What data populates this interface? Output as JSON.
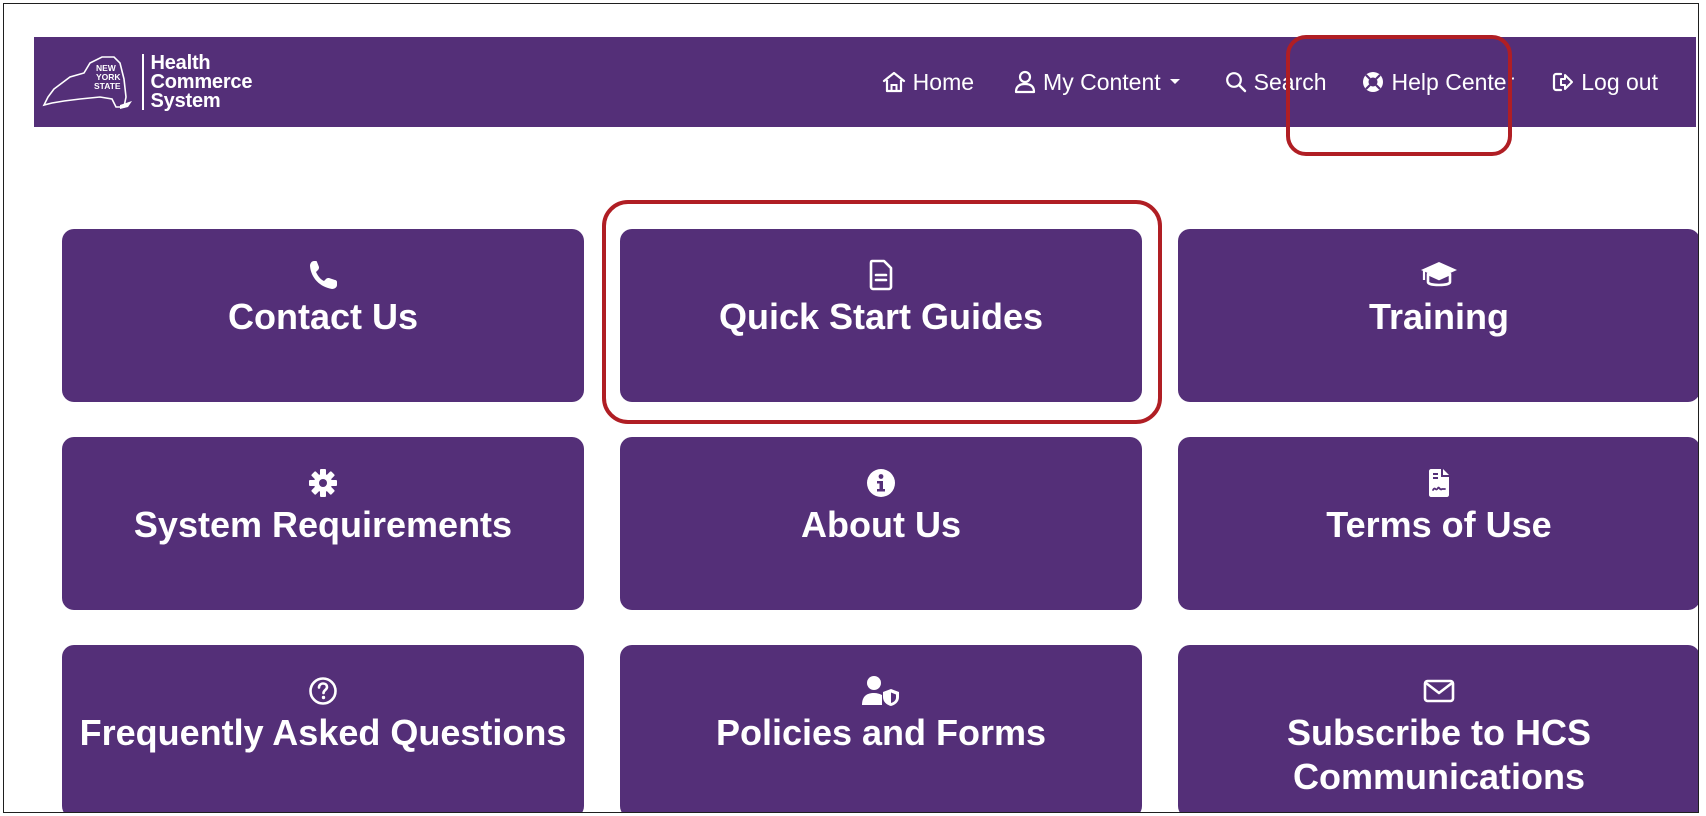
{
  "logo": {
    "state_lines": [
      "NEW",
      "YORK",
      "STATE"
    ],
    "system_lines": [
      "Health",
      "Commerce",
      "System"
    ]
  },
  "nav": {
    "items": [
      {
        "label": "Home",
        "icon": "home-icon"
      },
      {
        "label": "My Content",
        "icon": "user-icon",
        "has_dropdown": true
      },
      {
        "label": "Search",
        "icon": "search-icon"
      },
      {
        "label": "Help Center",
        "icon": "life-ring-icon"
      },
      {
        "label": "Log out",
        "icon": "logout-icon"
      }
    ]
  },
  "tiles": [
    {
      "label": "Contact Us",
      "icon": "phone-icon"
    },
    {
      "label": "Quick Start Guides",
      "icon": "document-icon"
    },
    {
      "label": "Training",
      "icon": "graduation-cap-icon"
    },
    {
      "label": "System Requirements",
      "icon": "gear-icon"
    },
    {
      "label": "About Us",
      "icon": "info-icon"
    },
    {
      "label": "Terms of Use",
      "icon": "signed-document-icon"
    },
    {
      "label": "Frequently Asked Questions",
      "icon": "question-circle-icon"
    },
    {
      "label": "Policies and Forms",
      "icon": "user-shield-icon"
    },
    {
      "label": "Subscribe to HCS\nCommunications",
      "icon": "envelope-icon"
    }
  ],
  "colors": {
    "brand_purple": "#542f78",
    "highlight_red": "#b01e24",
    "text_white": "#ffffff"
  }
}
